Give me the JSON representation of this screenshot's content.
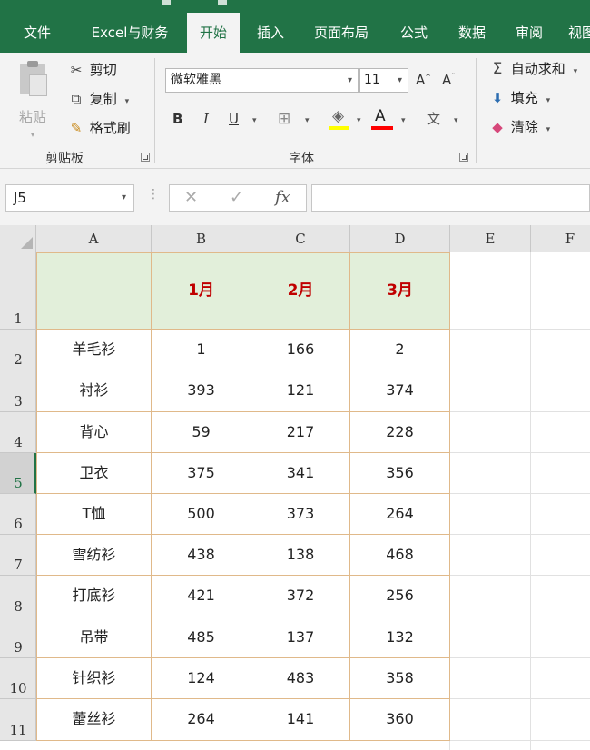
{
  "tabs": [
    {
      "label": "文件",
      "active": false
    },
    {
      "label": "Excel与财务",
      "active": false
    },
    {
      "label": "开始",
      "active": true
    },
    {
      "label": "插入",
      "active": false
    },
    {
      "label": "页面布局",
      "active": false
    },
    {
      "label": "公式",
      "active": false
    },
    {
      "label": "数据",
      "active": false
    },
    {
      "label": "审阅",
      "active": false
    },
    {
      "label": "视图",
      "active": false
    }
  ],
  "clipboard": {
    "paste_label": "粘贴",
    "cut_label": "剪切",
    "copy_label": "复制",
    "format_painter_label": "格式刷",
    "group_label": "剪贴板"
  },
  "font": {
    "font_name": "微软雅黑",
    "font_size": "11",
    "bold": "B",
    "italic": "I",
    "underline": "U",
    "grow": "A",
    "shrink": "A",
    "font_color_letter": "A",
    "phonetic": "文",
    "group_label": "字体",
    "fill_color": "#ffff00",
    "font_color": "#ff0000"
  },
  "editing": {
    "autosum_label": "自动求和",
    "fill_label": "填充",
    "clear_label": "清除"
  },
  "formula_bar": {
    "name_box": "J5",
    "fx": "fx",
    "cancel": "✕",
    "enter": "✓",
    "formula": ""
  },
  "grid": {
    "columns": [
      "A",
      "B",
      "C",
      "D",
      "E",
      "F"
    ],
    "rows": [
      "1",
      "2",
      "3",
      "4",
      "5",
      "6",
      "7",
      "8",
      "9",
      "10",
      "11"
    ],
    "selected_row": "5",
    "header_row": [
      "",
      "1月",
      "2月",
      "3月"
    ],
    "data": [
      [
        "羊毛衫",
        "1",
        "166",
        "2"
      ],
      [
        "衬衫",
        "393",
        "121",
        "374"
      ],
      [
        "背心",
        "59",
        "217",
        "228"
      ],
      [
        "卫衣",
        "375",
        "341",
        "356"
      ],
      [
        "T恤",
        "500",
        "373",
        "264"
      ],
      [
        "雪纺衫",
        "438",
        "138",
        "468"
      ],
      [
        "打底衫",
        "421",
        "372",
        "256"
      ],
      [
        "吊带",
        "485",
        "137",
        "132"
      ],
      [
        "针织衫",
        "124",
        "483",
        "358"
      ],
      [
        "蕾丝衫",
        "264",
        "141",
        "360"
      ]
    ]
  }
}
